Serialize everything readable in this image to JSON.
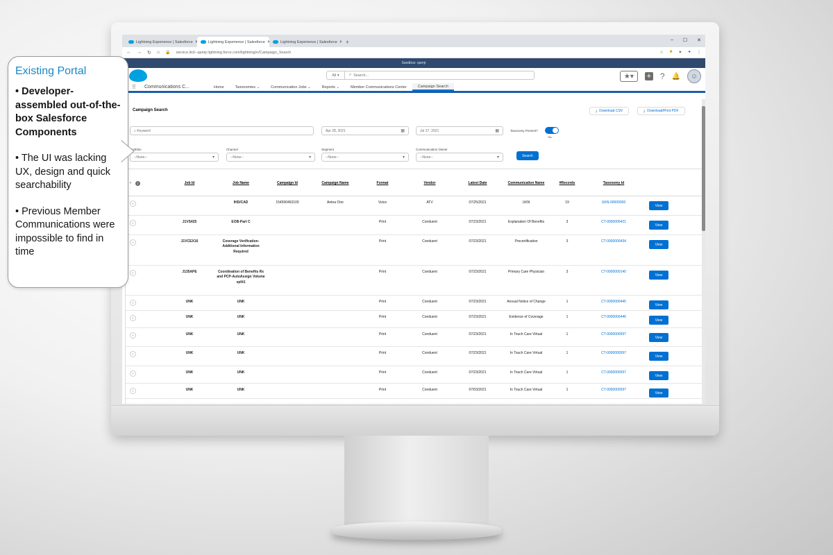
{
  "browser": {
    "tabs": [
      {
        "label": "Lightning Experience | Salesforce"
      },
      {
        "label": "Lightning Experience | Salesforce"
      },
      {
        "label": "Lightning Experience | Salesforce"
      }
    ],
    "new_tab": "+",
    "window_controls": [
      "–",
      "☐",
      "✕"
    ],
    "url": "service.lls0--qamjr.lightning.force.com/lightning/n/Campaign_Search"
  },
  "sandbox_banner": "Sandbox: qamjr",
  "header": {
    "search_scope": "All",
    "search_placeholder": "Search..."
  },
  "nav": {
    "app_name": "Communications C...",
    "items": [
      {
        "label": "Home"
      },
      {
        "label": "Taxonomies"
      },
      {
        "label": "Communication Jobs"
      },
      {
        "label": "Reports"
      },
      {
        "label": "Member Communications Center"
      },
      {
        "label": "Campaign Search"
      }
    ],
    "active_index": 5
  },
  "page": {
    "title": "Campaign Search",
    "download_csv": "Download CSV",
    "download_pdf": "Download/Print PDF"
  },
  "filters": {
    "keyword_placeholder": "Keyword",
    "date_from": "Apr 28, 2021",
    "date_to": "Jul 27, 2021",
    "taxonomy_label": "Taxonomy Present?",
    "taxonomy_value": "Yes",
    "portfolio_label": "Portfolio",
    "channel_label": "Channel",
    "segment_label": "Segment",
    "owner_label": "Communication Owner",
    "none_option": "--None--",
    "search_button": "Search"
  },
  "table": {
    "columns": [
      "Job Id",
      "Job Name",
      "Campaign Id",
      "Campaign Name",
      "Format",
      "Vendor",
      "Latest Date",
      "Communication Name",
      "#Records",
      "Taxonomy Id"
    ],
    "view_label": "View",
    "rows": [
      {
        "job_id": "",
        "job_name": "IHD/CAD",
        "campaign_id": "154590463100",
        "campaign_name": "Aetna One",
        "format": "Voice",
        "vendor": "ATV",
        "latest_date": "07/25/2021",
        "comm_name": "UKN",
        "records": "19",
        "taxonomy_id": "UKN-00000000"
      },
      {
        "job_id": "J1VS425",
        "job_name": "EOB-Part C",
        "campaign_id": "",
        "campaign_name": "",
        "format": "Print",
        "vendor": "Conduent",
        "latest_date": "07/23/2021",
        "comm_name": "Explanation Of Benefits",
        "records": "3",
        "taxonomy_id": "CT-0000000421"
      },
      {
        "job_id": "J1VCEX16",
        "job_name": "Coverage Verification-Additional Information Required",
        "campaign_id": "",
        "campaign_name": "",
        "format": "Print",
        "vendor": "Conduent",
        "latest_date": "07/23/2021",
        "comm_name": "Precertification",
        "records": "3",
        "taxonomy_id": "CT-0000000434"
      },
      {
        "job_id": "J135APE",
        "job_name": "Coordination of Benefits Rx and PCP-AutoAssign Volume split1",
        "campaign_id": "",
        "campaign_name": "",
        "format": "Print",
        "vendor": "Conduent",
        "latest_date": "07/23/2021",
        "comm_name": "Primary Care Physician",
        "records": "3",
        "taxonomy_id": "CT-0000000140"
      },
      {
        "job_id": "UNK",
        "job_name": "UNK",
        "campaign_id": "",
        "campaign_name": "",
        "format": "Print",
        "vendor": "Conduent",
        "latest_date": "07/23/2021",
        "comm_name": "Annual Notice of Change",
        "records": "1",
        "taxonomy_id": "CT-0000000445"
      },
      {
        "job_id": "UNK",
        "job_name": "UNK",
        "campaign_id": "",
        "campaign_name": "",
        "format": "Print",
        "vendor": "Conduent",
        "latest_date": "07/23/2021",
        "comm_name": "Evidence of Coverage",
        "records": "1",
        "taxonomy_id": "CT-0000000446"
      },
      {
        "job_id": "UNK",
        "job_name": "UNK",
        "campaign_id": "",
        "campaign_name": "",
        "format": "Print",
        "vendor": "Conduent",
        "latest_date": "07/23/2021",
        "comm_name": "In Touch Care Virtual",
        "records": "1",
        "taxonomy_id": "CT-0000000597"
      },
      {
        "job_id": "UNK",
        "job_name": "UNK",
        "campaign_id": "",
        "campaign_name": "",
        "format": "Print",
        "vendor": "Conduent",
        "latest_date": "07/23/2021",
        "comm_name": "In Touch Care Virtual",
        "records": "1",
        "taxonomy_id": "CT-0000000597"
      },
      {
        "job_id": "UNK",
        "job_name": "UNK",
        "campaign_id": "",
        "campaign_name": "",
        "format": "Print",
        "vendor": "Conduent",
        "latest_date": "07/23/2021",
        "comm_name": "In Touch Care Virtual",
        "records": "1",
        "taxonomy_id": "CT-0000000597"
      },
      {
        "job_id": "UNK",
        "job_name": "UNK",
        "campaign_id": "",
        "campaign_name": "",
        "format": "Print",
        "vendor": "Conduent",
        "latest_date": "07/03/2021",
        "comm_name": "In Touch Care Virtual",
        "records": "1",
        "taxonomy_id": "CT-0000000597"
      }
    ]
  },
  "callout": {
    "title": "Existing Portal",
    "bullet_1": "• Developer-assembled out-of-the-box Salesforce Components",
    "bullet_2": "• The UI was lacking UX, design and quick searchability",
    "bullet_3": "• Previous Member Communications were impossible to find in time"
  },
  "colors": {
    "accent": "#0070d2",
    "callout_title": "#1c86c4",
    "sandbox_banner": "#2f4a6e",
    "nav_bar": "#1a5dab"
  },
  "icons": [
    "salesforce-cloud-icon",
    "search-icon",
    "star-icon",
    "plus-icon",
    "help-icon",
    "bell-icon",
    "avatar-icon",
    "calendar-icon",
    "download-icon",
    "chevron-down-icon",
    "expand-icon",
    "info-icon",
    "waffle-icon"
  ]
}
